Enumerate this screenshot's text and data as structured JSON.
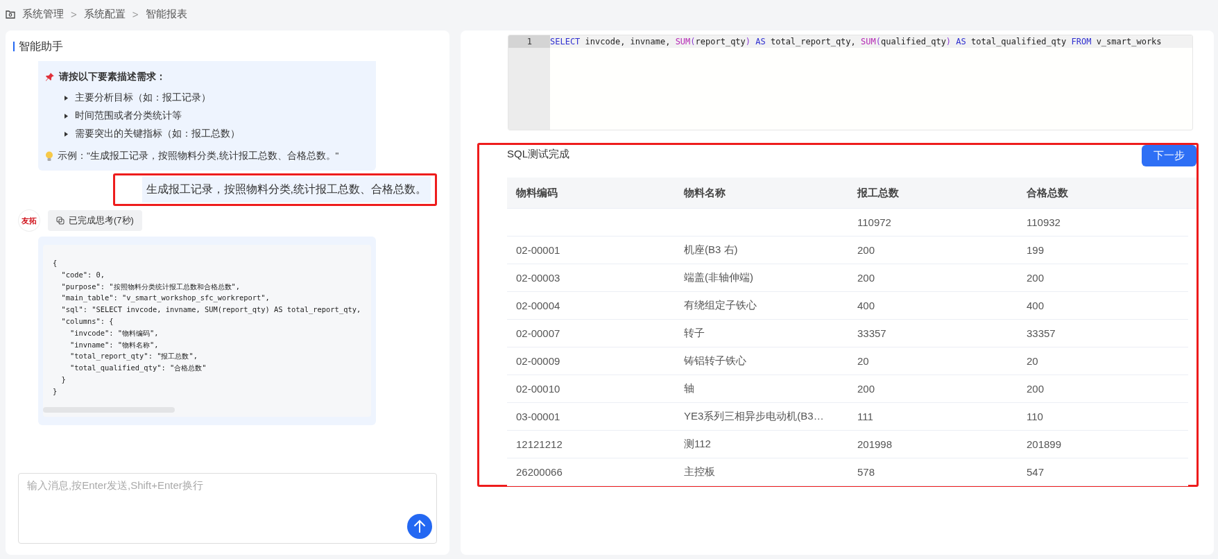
{
  "breadcrumb": {
    "items": [
      "系统管理",
      "系统配置",
      "智能报表"
    ],
    "separator": ">"
  },
  "assistant": {
    "title": "智能助手",
    "intro": {
      "heading": "请按以下要素描述需求：",
      "bullets": [
        "主要分析目标（如：报工记录）",
        "时间范围或者分类统计等",
        "需要突出的关键指标（如：报工总数）"
      ],
      "example": "示例：\"生成报工记录，按照物料分类,统计报工总数、合格总数。\""
    },
    "user_message": {
      "text": "生成报工记录，按照物料分类,统计报工总数、合格总数。",
      "highlighted": true
    },
    "avatar": {
      "text": "友拓"
    },
    "thinking": {
      "label": "已完成思考(7秒)"
    },
    "code_lines": [
      "{",
      "  \"code\": 0,",
      "  \"purpose\": \"按照物料分类统计报工总数和合格总数\",",
      "  \"main_table\": \"v_smart_workshop_sfc_workreport\",",
      "  \"sql\": \"SELECT invcode, invname, SUM(report_qty) AS total_report_qty,",
      "  \"columns\": {",
      "    \"invcode\": \"物料编码\",",
      "    \"invname\": \"物料名称\",",
      "    \"total_report_qty\": \"报工总数\",",
      "    \"total_qualified_qty\": \"合格总数\"",
      "  }",
      "}"
    ],
    "input": {
      "placeholder": "输入消息,按Enter发送,Shift+Enter换行"
    }
  },
  "editor": {
    "line_number": "1",
    "tokens": [
      {
        "text": "SELECT",
        "kind": "keyword"
      },
      {
        "text": " invcode, invname, ",
        "kind": "plain"
      },
      {
        "text": "SUM",
        "kind": "function"
      },
      {
        "text": "(",
        "kind": "paren"
      },
      {
        "text": "report_qty",
        "kind": "plain"
      },
      {
        "text": ")",
        "kind": "paren"
      },
      {
        "text": " AS",
        "kind": "keyword"
      },
      {
        "text": " total_report_qty, ",
        "kind": "plain"
      },
      {
        "text": "SUM",
        "kind": "function"
      },
      {
        "text": "(",
        "kind": "paren"
      },
      {
        "text": "qualified_qty",
        "kind": "plain"
      },
      {
        "text": ")",
        "kind": "paren"
      },
      {
        "text": " AS",
        "kind": "keyword"
      },
      {
        "text": " total_qualified_qty ",
        "kind": "plain"
      },
      {
        "text": "FROM",
        "kind": "keyword"
      },
      {
        "text": " v_smart_works",
        "kind": "plain"
      }
    ]
  },
  "result": {
    "highlighted": true,
    "status": "SQL测试完成",
    "next_button": "下一步",
    "table": {
      "columns": [
        "物料编码",
        "物料名称",
        "报工总数",
        "合格总数"
      ],
      "rows": [
        [
          "",
          "",
          "110972",
          "110932"
        ],
        [
          "02-00001",
          "机座(B3 右)",
          "200",
          "199"
        ],
        [
          "02-00003",
          "端盖(非轴伸端)",
          "200",
          "200"
        ],
        [
          "02-00004",
          "有绕组定子铁心",
          "400",
          "400"
        ],
        [
          "02-00007",
          "转子",
          "33357",
          "33357"
        ],
        [
          "02-00009",
          "铸铝转子铁心",
          "20",
          "20"
        ],
        [
          "02-00010",
          "轴",
          "200",
          "200"
        ],
        [
          "03-00001",
          "YE3系列三相异步电动机(B3…",
          "111",
          "110"
        ],
        [
          "12121212",
          "测112",
          "201998",
          "201899"
        ],
        [
          "26200066",
          "主控板",
          "578",
          "547"
        ]
      ]
    }
  }
}
